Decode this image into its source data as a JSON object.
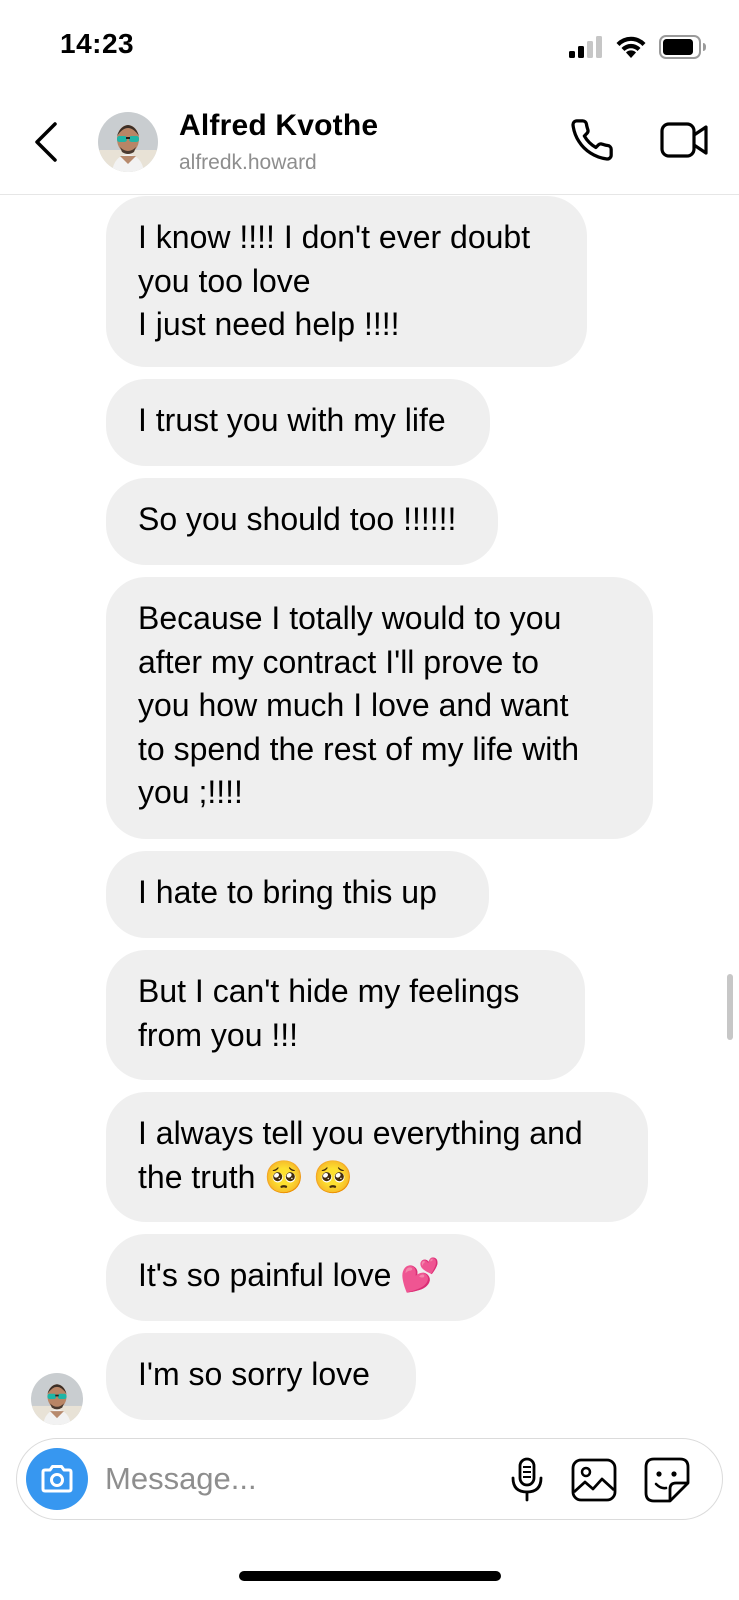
{
  "status_bar": {
    "time": "14:23",
    "icons": [
      "cellular-signal-icon",
      "wifi-icon",
      "battery-icon"
    ]
  },
  "header": {
    "contact_name": "Alfred Kvothe",
    "username": "alfredk.howard",
    "icons": {
      "back": "chevron-left-icon",
      "call": "phone-icon",
      "video": "video-camera-icon"
    }
  },
  "messages": [
    {
      "text": "I know !!!! I don't ever doubt\nyou too love\nI just need help !!!!"
    },
    {
      "text": "I trust you with my life"
    },
    {
      "text": "So you should too !!!!!!"
    },
    {
      "text": "Because I totally would to you\nafter my contract I'll prove to\nyou how much I love and want\nto spend the rest of my life with\nyou ;!!!!"
    },
    {
      "text": "I hate to bring this up"
    },
    {
      "text": "But I can't hide my feelings\nfrom you !!!"
    },
    {
      "text": "I always tell you everything and\nthe truth 🥺 🥺"
    },
    {
      "text": "It's so painful love 💕"
    },
    {
      "text": "I'm so sorry love"
    }
  ],
  "composer": {
    "placeholder": "Message...",
    "icons": [
      "camera-icon",
      "microphone-icon",
      "gallery-icon",
      "sticker-icon"
    ]
  },
  "colors": {
    "bubble_background": "#efefef",
    "camera_button": "#3797f0",
    "secondary_text": "#8e8e8e"
  }
}
